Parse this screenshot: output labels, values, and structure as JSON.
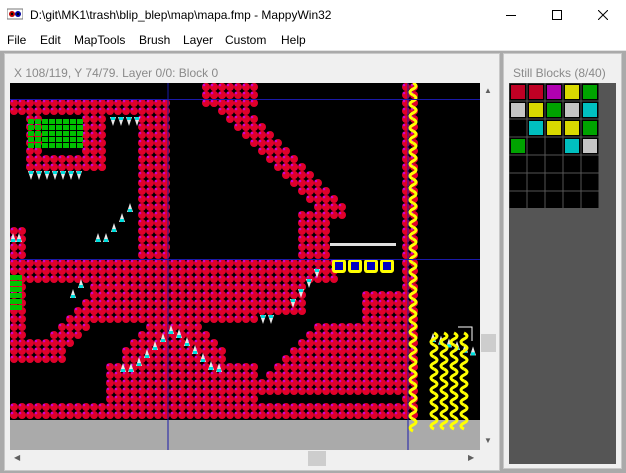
{
  "window": {
    "title": "D:\\git\\MK1\\trash\\blip_blep\\map\\mapa.fmp - MappyWin32",
    "minimize_icon": "minimize-icon",
    "maximize_icon": "maximize-icon",
    "close_icon": "close-icon"
  },
  "menu": {
    "items": [
      "File",
      "Edit",
      "MapTools",
      "Brush",
      "Layer",
      "Custom",
      "Help"
    ]
  },
  "map_panel": {
    "status": "X 108/119, Y 74/79. Layer 0/0: Block 0"
  },
  "blocks_panel": {
    "title": "Still Blocks (8/40)"
  },
  "colors": {
    "tile_red": "#e0002a",
    "tile_magenta": "#d000d0",
    "tile_yellow": "#ffff00",
    "spike_cyan": "#00e0e0",
    "foliage_green": "#00c000",
    "grid_blue": "#0000c0",
    "void": "#000000"
  }
}
